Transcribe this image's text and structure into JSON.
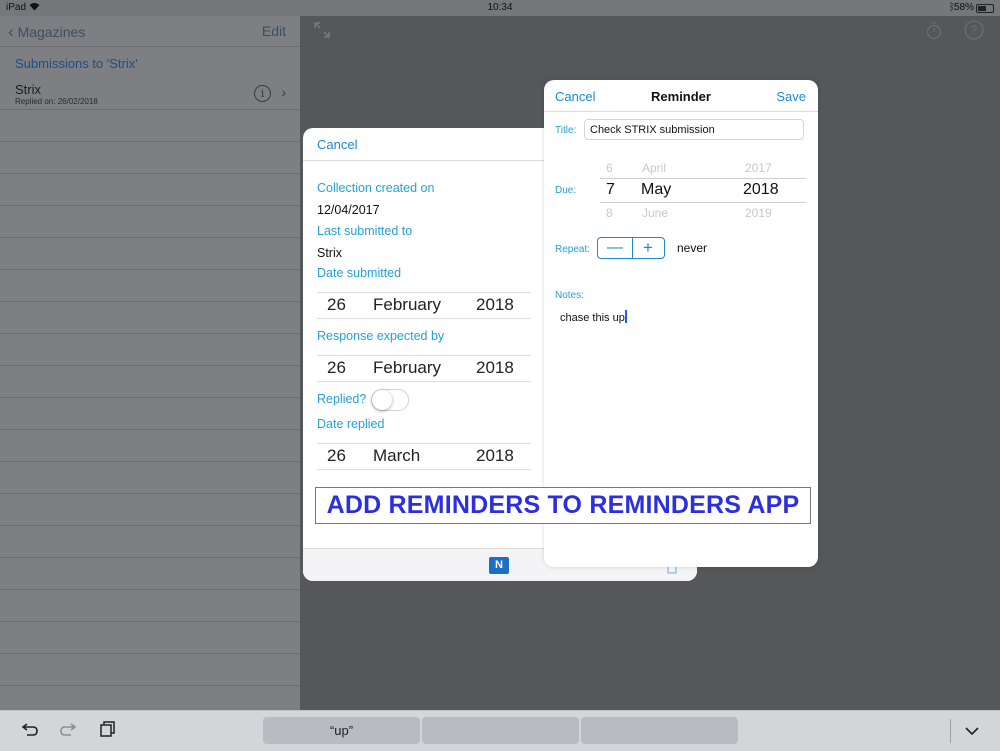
{
  "status_bar": {
    "device": "iPad",
    "wifi_icon": "wifi-icon",
    "time": "10:34",
    "bluetooth_icon": "bluetooth-icon",
    "battery": "58%",
    "battery_level": 0.58
  },
  "master": {
    "back_label": "Magazines",
    "edit_label": "Edit",
    "section_title": "Submissions to 'Strix'",
    "rows": [
      {
        "title": "Strix",
        "subtitle": "Replied on: 26/02/2018"
      }
    ]
  },
  "detail_toolbar_icons": [
    "expand-icon",
    "timer-icon",
    "help-icon"
  ],
  "collection_panel": {
    "cancel_label": "Cancel",
    "collection_created_label": "Collection created on",
    "collection_created_value": "12/04/2017",
    "last_submitted_label": "Last submitted to",
    "last_submitted_value": "Strix",
    "date_submitted_label": "Date submitted",
    "date_submitted": {
      "day": "26",
      "month": "February",
      "year": "2018"
    },
    "response_expected_label": "Response expected by",
    "response_expected": {
      "day": "26",
      "month": "February",
      "year": "2018"
    },
    "replied_label": "Replied?",
    "replied": false,
    "date_replied_label": "Date replied",
    "date_replied": {
      "day": "26",
      "month": "March",
      "year": "2018"
    },
    "footer_icons": [
      "onenote-icon",
      "document-icon"
    ]
  },
  "reminder": {
    "cancel_label": "Cancel",
    "title": "Reminder",
    "save_label": "Save",
    "title_label": "Title:",
    "title_value": "Check STRIX submission",
    "due_label": "Due:",
    "due_picker": {
      "days": [
        "6",
        "7",
        "8"
      ],
      "months": [
        "April",
        "May",
        "June"
      ],
      "years": [
        "2017",
        "2018",
        "2019"
      ]
    },
    "repeat_label": "Repeat:",
    "repeat_minus": "—",
    "repeat_plus": "+",
    "repeat_value": "never",
    "notes_label": "Notes:",
    "notes_value": "chase this up"
  },
  "banner_text": "ADD REMINDERS TO REMINDERS APP",
  "keyboard_bar": {
    "suggestions": [
      "“up”",
      "",
      ""
    ],
    "icons": [
      "undo-icon",
      "redo-icon",
      "paste-icon",
      "dismiss-keyboard-icon"
    ]
  }
}
